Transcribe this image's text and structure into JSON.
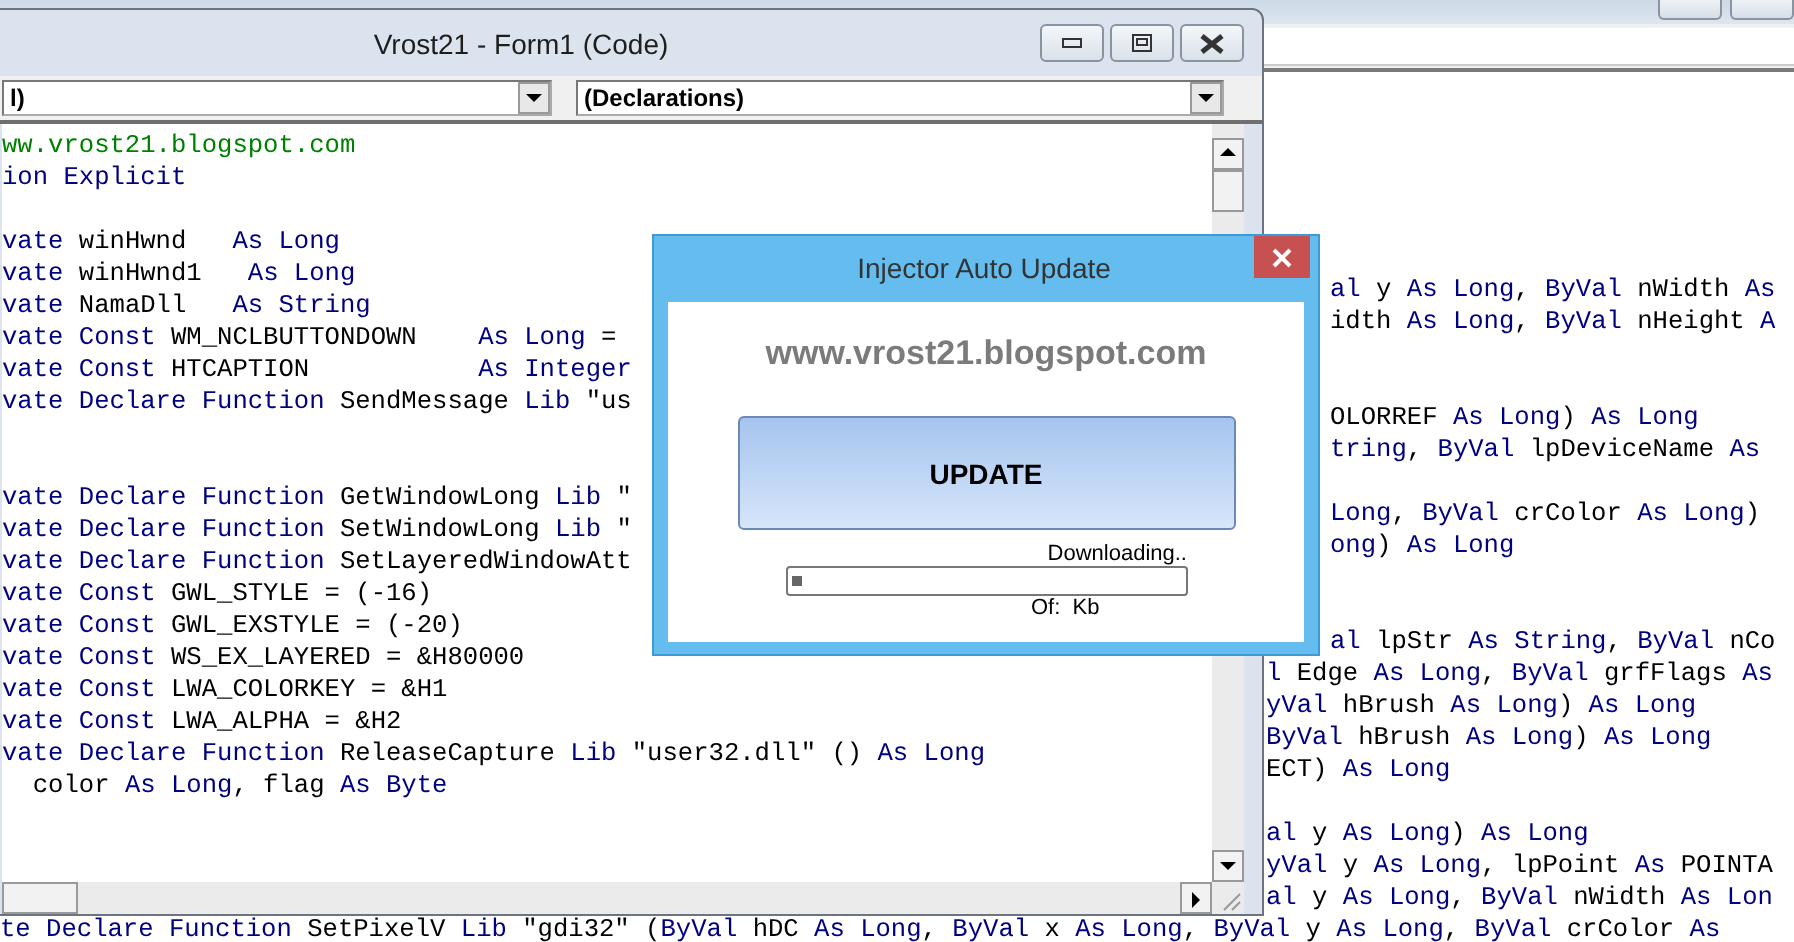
{
  "background_window": {
    "code_beside_dialog": [
      {
        "kind": "code",
        "keyword_first": true,
        "segments": [
          "al ",
          "y ",
          "As Long",
          ", ",
          "ByVal ",
          "nWidth ",
          "As"
        ]
      },
      {
        "kind": "code",
        "keyword_first": false,
        "segments": [
          "idth ",
          "As Long",
          ", ",
          "ByVal ",
          "nHeight ",
          "A"
        ]
      },
      {
        "kind": "blank"
      },
      {
        "kind": "blank"
      },
      {
        "kind": "code",
        "keyword_first": false,
        "segments": [
          "OLORREF ",
          "As Long",
          ") ",
          "As Long"
        ]
      },
      {
        "kind": "code",
        "keyword_first": true,
        "segments": [
          "tring",
          ", ",
          "ByVal ",
          "lpDeviceName ",
          "As"
        ]
      },
      {
        "kind": "blank"
      },
      {
        "kind": "code",
        "keyword_first": true,
        "segments": [
          "Long",
          ", ",
          "ByVal ",
          "crColor ",
          "As Long",
          ")"
        ]
      },
      {
        "kind": "code",
        "keyword_first": true,
        "segments": [
          "ong",
          ") ",
          "As Long"
        ]
      },
      {
        "kind": "blank"
      },
      {
        "kind": "blank"
      },
      {
        "kind": "code",
        "keyword_first": true,
        "segments": [
          "al ",
          "lpStr ",
          "As String",
          ", ",
          "ByVal ",
          "nCo"
        ]
      }
    ],
    "code_below_dialog": [
      {
        "kind": "code",
        "keyword_first": true,
        "segments": [
          "l ",
          "Edge ",
          "As Long",
          ", ",
          "ByVal ",
          "grfFlags ",
          "As"
        ]
      },
      {
        "kind": "code",
        "keyword_first": true,
        "segments": [
          "yVal ",
          "hBrush ",
          "As Long",
          ") ",
          "As Long"
        ]
      },
      {
        "kind": "code",
        "keyword_first": true,
        "segments": [
          "ByVal ",
          "hBrush ",
          "As Long",
          ") ",
          "As Long"
        ]
      },
      {
        "kind": "code",
        "keyword_first": false,
        "segments": [
          "ECT) ",
          "As Long"
        ]
      },
      {
        "kind": "blank"
      },
      {
        "kind": "code",
        "keyword_first": true,
        "segments": [
          "al ",
          "y ",
          "As Long",
          ") ",
          "As Long"
        ]
      },
      {
        "kind": "code",
        "keyword_first": true,
        "segments": [
          "yVal ",
          "y ",
          "As Long",
          ", lpPoint ",
          "As ",
          "POINTA"
        ]
      },
      {
        "kind": "code",
        "keyword_first": true,
        "segments": [
          "al ",
          "y ",
          "As Long",
          ", ",
          "ByVal ",
          "nWidth ",
          "As Lon"
        ]
      }
    ],
    "bottom_line": {
      "keyword_first": true,
      "segments": [
        "te Declare Function ",
        "SetPixelV ",
        "Lib ",
        "\"gdi32\" (",
        "ByVal ",
        "hDC ",
        "As Long",
        ", ",
        "ByVal ",
        "x ",
        "As Long",
        ", ",
        "ByVal ",
        "y ",
        "As Long",
        ", ",
        "ByVal ",
        "crColor ",
        "As"
      ]
    }
  },
  "code_window": {
    "title": "Vrost21 - Form1 (Code)",
    "object_combo": {
      "value": "l)"
    },
    "procedure_combo": {
      "value": "(Declarations)"
    },
    "code_lines": [
      {
        "kind": "comment",
        "segments": [
          "ww.vrost21.blogspot.com"
        ]
      },
      {
        "kind": "code",
        "keyword_first": true,
        "segments": [
          "ion Explicit"
        ]
      },
      {
        "kind": "blank"
      },
      {
        "kind": "code",
        "keyword_first": true,
        "segments": [
          "vate ",
          "winHwnd   ",
          "As Long"
        ]
      },
      {
        "kind": "code",
        "keyword_first": true,
        "segments": [
          "vate ",
          "winHwnd1   ",
          "As Long"
        ]
      },
      {
        "kind": "code",
        "keyword_first": true,
        "segments": [
          "vate ",
          "NamaDll   ",
          "As String"
        ]
      },
      {
        "kind": "code",
        "keyword_first": true,
        "segments": [
          "vate Const ",
          "WM_NCLBUTTONDOWN    ",
          "As Long ",
          "="
        ]
      },
      {
        "kind": "code",
        "keyword_first": true,
        "segments": [
          "vate Const ",
          "HTCAPTION           ",
          "As Integer"
        ]
      },
      {
        "kind": "code",
        "keyword_first": true,
        "segments": [
          "vate Declare Function ",
          "SendMessage ",
          "Lib ",
          "\"us"
        ]
      },
      {
        "kind": "blank"
      },
      {
        "kind": "blank"
      },
      {
        "kind": "code",
        "keyword_first": true,
        "segments": [
          "vate Declare Function ",
          "GetWindowLong ",
          "Lib ",
          "\""
        ]
      },
      {
        "kind": "code",
        "keyword_first": true,
        "segments": [
          "vate Declare Function ",
          "SetWindowLong ",
          "Lib ",
          "\""
        ]
      },
      {
        "kind": "code",
        "keyword_first": true,
        "segments": [
          "vate Declare Function ",
          "SetLayeredWindowAtt"
        ]
      },
      {
        "kind": "code",
        "keyword_first": true,
        "segments": [
          "vate Const ",
          "GWL_STYLE = (-16)"
        ]
      },
      {
        "kind": "code",
        "keyword_first": true,
        "segments": [
          "vate Const ",
          "GWL_EXSTYLE = (-20)"
        ]
      },
      {
        "kind": "code",
        "keyword_first": true,
        "segments": [
          "vate Const ",
          "WS_EX_LAYERED = &H80000"
        ]
      },
      {
        "kind": "code",
        "keyword_first": true,
        "segments": [
          "vate Const ",
          "LWA_COLORKEY = &H1"
        ]
      },
      {
        "kind": "code",
        "keyword_first": true,
        "segments": [
          "vate Const ",
          "LWA_ALPHA = &H2"
        ]
      },
      {
        "kind": "code",
        "keyword_first": true,
        "segments": [
          "vate Declare Function ",
          "ReleaseCapture ",
          "Lib ",
          "\"user32.dll\" () ",
          "As Long"
        ]
      },
      {
        "kind": "code",
        "keyword_first": false,
        "segments": [
          "  color ",
          "As Long",
          ", flag ",
          "As Byte"
        ]
      }
    ]
  },
  "dialog": {
    "title": "Injector Auto Update",
    "link": "www.vrost21.blogspot.com",
    "button": "UPDATE",
    "status": "Downloading..",
    "progress": {
      "level": 0.03
    },
    "size_label": "Of:  Kb"
  }
}
